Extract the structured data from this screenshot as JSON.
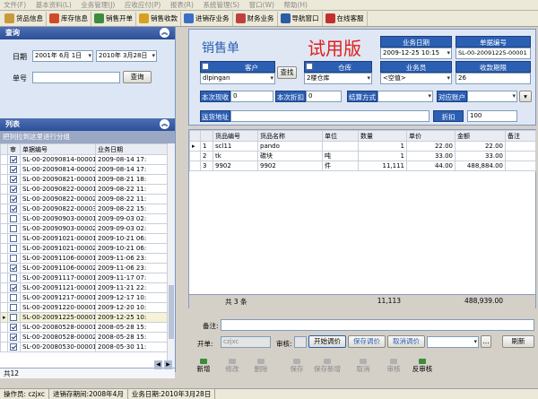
{
  "menu": [
    "文件(F)",
    "基本资料(L)",
    "业务管理(J)",
    "应收应付(P)",
    "报表(R)",
    "系统管理(S)",
    "窗口(W)",
    "帮助(H)"
  ],
  "toolbar": {
    "items": [
      {
        "label": "货品信息",
        "color": "#c89a3c",
        "icon": "goods-icon"
      },
      {
        "label": "库存信息",
        "color": "#d04a2a",
        "icon": "stock-icon"
      },
      {
        "label": "销售开单",
        "color": "#3c8c3c",
        "icon": "sales-order-icon"
      },
      {
        "label": "销售收款",
        "color": "#d8a020",
        "icon": "payment-icon"
      },
      {
        "label": "进销存业务",
        "color": "#3a6ec8",
        "icon": "business-icon"
      },
      {
        "label": "财务业务",
        "color": "#c04040",
        "icon": "finance-icon"
      },
      {
        "label": "导航窗口",
        "color": "#2a5ca8",
        "icon": "nav-icon"
      },
      {
        "label": "在线客服",
        "color": "#c03030",
        "icon": "support-icon"
      }
    ]
  },
  "query": {
    "title": "查询",
    "date_label": "日期",
    "date_from": "2001年 6月 1日",
    "date_to": "2010年 3月28日",
    "no_label": "单号",
    "no_value": "",
    "search_btn": "查询"
  },
  "list": {
    "title": "列表",
    "group_hint": "把列拉到这里进行分组",
    "headers": [
      "审",
      "单据编号",
      "业务日期"
    ],
    "rows": [
      {
        "no": "SL-00-20090814-00001",
        "date": "2009-08-14 17:",
        "checked": true
      },
      {
        "no": "SL-00-20090814-00002",
        "date": "2009-08-14 17:",
        "checked": true
      },
      {
        "no": "SL-00-20090821-00001",
        "date": "2009-08-21 18:",
        "checked": true
      },
      {
        "no": "SL-00-20090822-00001",
        "date": "2009-08-22 11:",
        "checked": true
      },
      {
        "no": "SL-00-20090822-00002",
        "date": "2009-08-22 11:",
        "checked": true
      },
      {
        "no": "SL-00-20090822-00003",
        "date": "2009-08-22 15:",
        "checked": true
      },
      {
        "no": "SL-00-20090903-00001",
        "date": "2009-09-03 02:",
        "checked": false
      },
      {
        "no": "SL-00-20090903-00002",
        "date": "2009-09-03 02:",
        "checked": false
      },
      {
        "no": "SL-00-20091021-00001",
        "date": "2009-10-21 06:",
        "checked": false
      },
      {
        "no": "SL-00-20091021-00002",
        "date": "2009-10-21 06:",
        "checked": false
      },
      {
        "no": "SL-00-20091106-00001",
        "date": "2009-11-06 23:",
        "checked": false
      },
      {
        "no": "SL-00-20091106-00002",
        "date": "2009-11-06 23:",
        "checked": true
      },
      {
        "no": "SL-00-20091117-00001",
        "date": "2009-11-17 07:",
        "checked": false
      },
      {
        "no": "SL-00-20091121-00001",
        "date": "2009-11-21 22:",
        "checked": true
      },
      {
        "no": "SL-00-20091217-00001",
        "date": "2009-12-17 10:",
        "checked": false
      },
      {
        "no": "SL-00-20091220-00001",
        "date": "2009-12-20 10:",
        "checked": false
      },
      {
        "no": "SL-00-20091225-00001",
        "date": "2009-12-25 10:",
        "checked": false
      },
      {
        "no": "SL-00-20080528-00001",
        "date": "2008-05-28 15:",
        "checked": true
      },
      {
        "no": "SL-00-20080528-00002",
        "date": "2008-05-28 15:",
        "checked": true
      },
      {
        "no": "SL-00-20080530-00001",
        "date": "2008-05-30 11:",
        "checked": true
      }
    ],
    "footer": "共12"
  },
  "form": {
    "title": "销售单",
    "watermark": "试用版",
    "biz_date_label": "业务日期",
    "biz_date": "2009-12-25 10:15",
    "doc_no_label": "单据编号",
    "doc_no": "SL-00-20091225-00001",
    "customer_label": "客户",
    "customer": "dlpingan",
    "search_btn": "查找",
    "warehouse_label": "仓库",
    "warehouse": "2楼仓库",
    "salesman_label": "业务员",
    "salesman": "<空值>",
    "term_label": "收款期限",
    "term": "26",
    "receipt_label": "本次现收",
    "receipt": "0",
    "discount_label": "本次折扣",
    "discount": "0",
    "settle_label": "结算方式",
    "settle": "",
    "account_label": "对应账户",
    "account": "",
    "addr_label": "送货地址",
    "addr": "",
    "rebate_label": "折扣",
    "rebate": "100"
  },
  "detail": {
    "headers": [
      "货品编号",
      "货品名称",
      "单位",
      "数量",
      "单价",
      "金额",
      "备注"
    ],
    "rows": [
      {
        "idx": "1",
        "code": "scl11",
        "name": "pando",
        "unit": "",
        "qty": "1",
        "price": "22.00",
        "amount": "22.00"
      },
      {
        "idx": "2",
        "code": "tk",
        "name": "碳块",
        "unit": "吨",
        "qty": "1",
        "price": "33.00",
        "amount": "33.00"
      },
      {
        "idx": "3",
        "code": "9902",
        "name": "9902",
        "unit": "件",
        "qty": "11,111",
        "price": "44.00",
        "amount": "488,884.00"
      }
    ],
    "footer": {
      "count": "共 3 条",
      "qty": "11,113",
      "amount": "488,939.00"
    }
  },
  "bottom": {
    "note_label": "备注:",
    "opener_label": "开单:",
    "opener": "czjxc",
    "auditor_label": "审核:",
    "btn_start_adjust": "开始调价",
    "btn_save_adjust": "保存调价",
    "btn_cancel_adjust": "取消调价",
    "btn_refresh": "刷新"
  },
  "actions": [
    {
      "label": "新增",
      "enabled": true,
      "icon": "add-icon"
    },
    {
      "label": "修改",
      "enabled": false,
      "icon": "edit-icon"
    },
    {
      "label": "删除",
      "enabled": false,
      "icon": "delete-icon"
    },
    {
      "label": "保存",
      "enabled": false,
      "icon": "save-icon"
    },
    {
      "label": "保存新增",
      "enabled": false,
      "icon": "save-new-icon"
    },
    {
      "label": "取消",
      "enabled": false,
      "icon": "cancel-icon"
    },
    {
      "label": "审核",
      "enabled": false,
      "icon": "audit-icon"
    },
    {
      "label": "反审核",
      "enabled": true,
      "icon": "unaudit-icon"
    }
  ],
  "status": {
    "operator": "操作员: czjxc",
    "period": "进销存期间:2008年4月",
    "biz_date": "业务日期:2010年3月28日"
  }
}
